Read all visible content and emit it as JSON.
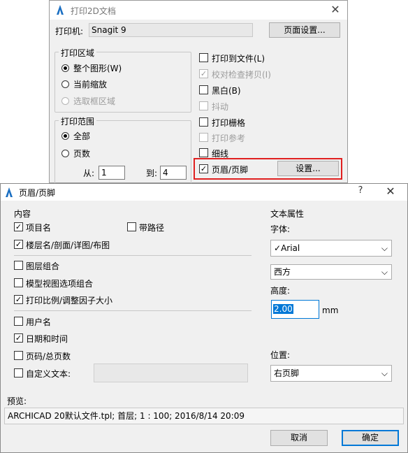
{
  "print_window": {
    "title": "打印2D文档",
    "printer_label": "打印机:",
    "printer_value": "Snagit 9",
    "page_setup_button": "页面设置...",
    "area_group": {
      "label": "打印区域",
      "options": [
        {
          "label": "整个图形(W)",
          "selected": true,
          "disabled": false
        },
        {
          "label": "当前缩放",
          "selected": false,
          "disabled": false
        },
        {
          "label": "选取框区域",
          "selected": false,
          "disabled": true
        }
      ]
    },
    "range_group": {
      "label": "打印范围",
      "all_label": "全部",
      "pages_label": "页数",
      "from_label": "从:",
      "from_value": "1",
      "to_label": "到:",
      "to_value": "4"
    },
    "options": [
      {
        "label": "打印到文件(L)",
        "checked": false,
        "disabled": false
      },
      {
        "label": "校对检查拷贝(I)",
        "checked": true,
        "disabled": true
      },
      {
        "label": "黑白(B)",
        "checked": false,
        "disabled": false
      },
      {
        "label": "抖动",
        "checked": false,
        "disabled": true
      },
      {
        "label": "打印栅格",
        "checked": false,
        "disabled": false
      },
      {
        "label": "打印参考",
        "checked": false,
        "disabled": true
      },
      {
        "label": "细线",
        "checked": false,
        "disabled": false
      },
      {
        "label": "页眉/页脚",
        "checked": true,
        "disabled": false
      }
    ],
    "header_settings_button": "设置...",
    "highlight_color": "#e02020"
  },
  "header_footer_dialog": {
    "title": "页眉/页脚",
    "help": "?",
    "content_label": "内容",
    "items": {
      "project_name": {
        "label": "项目名",
        "checked": true
      },
      "with_path": {
        "label": "带路径",
        "checked": false
      },
      "story_name": {
        "label": "楼层名/剖面/详图/布图",
        "checked": true
      },
      "layer_combo": {
        "label": "图层组合",
        "checked": false
      },
      "model_view": {
        "label": "模型视图选项组合",
        "checked": false
      },
      "scale": {
        "label": "打印比例/调整因子大小",
        "checked": true
      },
      "user_name": {
        "label": "用户名",
        "checked": false
      },
      "date_time": {
        "label": "日期和时间",
        "checked": true
      },
      "page_number": {
        "label": "页码/总页数",
        "checked": false
      },
      "custom_text": {
        "label": "自定义文本:",
        "checked": false
      }
    },
    "text_props_label": "文本属性",
    "font_label": "字体:",
    "font_value": "Arial",
    "font_check": "✓",
    "script_value": "西方",
    "height_label": "高度:",
    "height_value": "2.00",
    "height_unit": "mm",
    "position_label": "位置:",
    "position_value": "右页脚",
    "preview_label": "预览:",
    "preview_text": "ARCHICAD 20默认文件.tpl; 首层; 1 : 100; 2016/8/14 20:09",
    "cancel_button": "取消",
    "ok_button": "确定",
    "accent_color": "#0078d7"
  }
}
